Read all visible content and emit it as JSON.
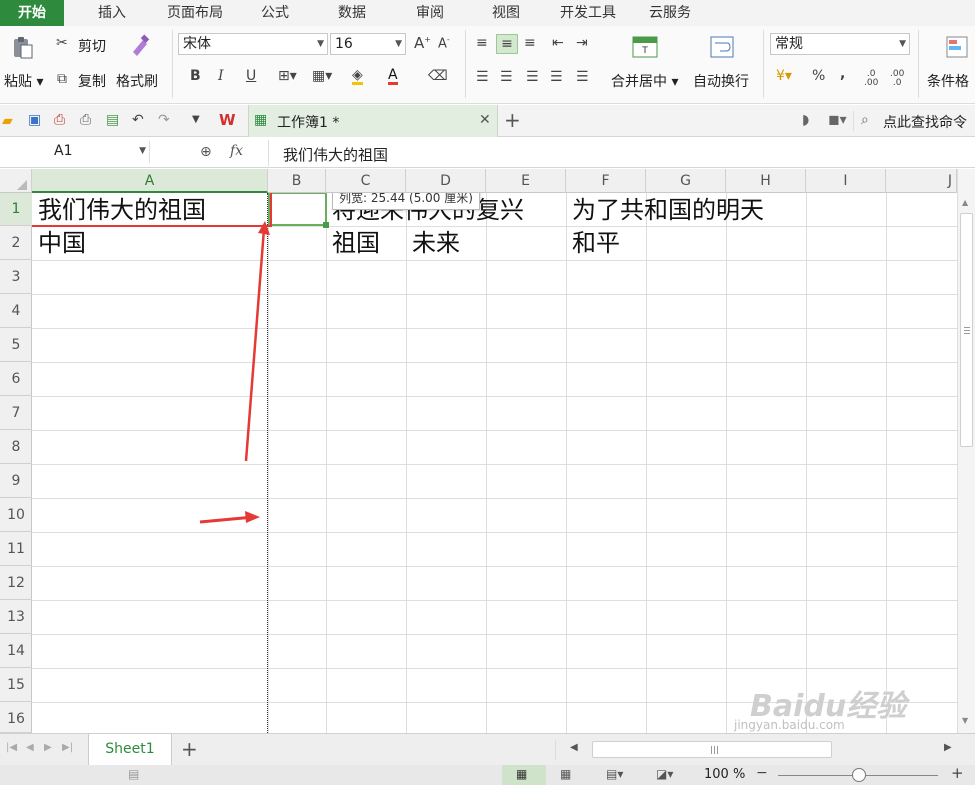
{
  "ribbon_tabs": [
    {
      "label": "开始",
      "active": true
    },
    {
      "label": "插入"
    },
    {
      "label": "页面布局"
    },
    {
      "label": "公式"
    },
    {
      "label": "数据"
    },
    {
      "label": "审阅"
    },
    {
      "label": "视图"
    },
    {
      "label": "开发工具"
    },
    {
      "label": "云服务"
    }
  ],
  "ribbon": {
    "paste": "粘贴",
    "cut": "剪切",
    "copy": "复制",
    "format_painter": "格式刷",
    "font_name": "宋体",
    "font_size": "16",
    "merge_center": "合并居中",
    "wrap_text": "自动换行",
    "number_format": "常规",
    "percent": "%",
    "comma": ",",
    "cond_format": "条件格"
  },
  "quickbar": {
    "doc_title": "工作簿1 *",
    "search_label": "点此查找命令"
  },
  "formula_bar": {
    "name_box": "A1",
    "fx": "fx",
    "content": "我们伟大的祖国"
  },
  "columns": [
    "A",
    "B",
    "C",
    "D",
    "E",
    "F",
    "G",
    "H",
    "I",
    "J"
  ],
  "rows": [
    "1",
    "2",
    "3",
    "4",
    "5",
    "6",
    "7",
    "8",
    "9",
    "10",
    "11",
    "12",
    "13",
    "14",
    "15",
    "16"
  ],
  "cells": {
    "A1": "我们伟大的祖国",
    "C1": "将迎来伟大的复兴",
    "F1": "为了共和国的明天",
    "A2": "中国",
    "C2": "祖国",
    "D2": "未来",
    "F2": "和平"
  },
  "tooltip": "列宽: 25.44 (5.00 厘米)",
  "sheets": [
    {
      "label": "Sheet1",
      "active": true
    }
  ],
  "status": {
    "zoom": "100 %"
  },
  "watermark": {
    "brand": "Baidu经验",
    "url": "jingyan.baidu.com"
  },
  "colors": {
    "accent": "#2e8b3e",
    "annotation_red": "#e53935"
  }
}
